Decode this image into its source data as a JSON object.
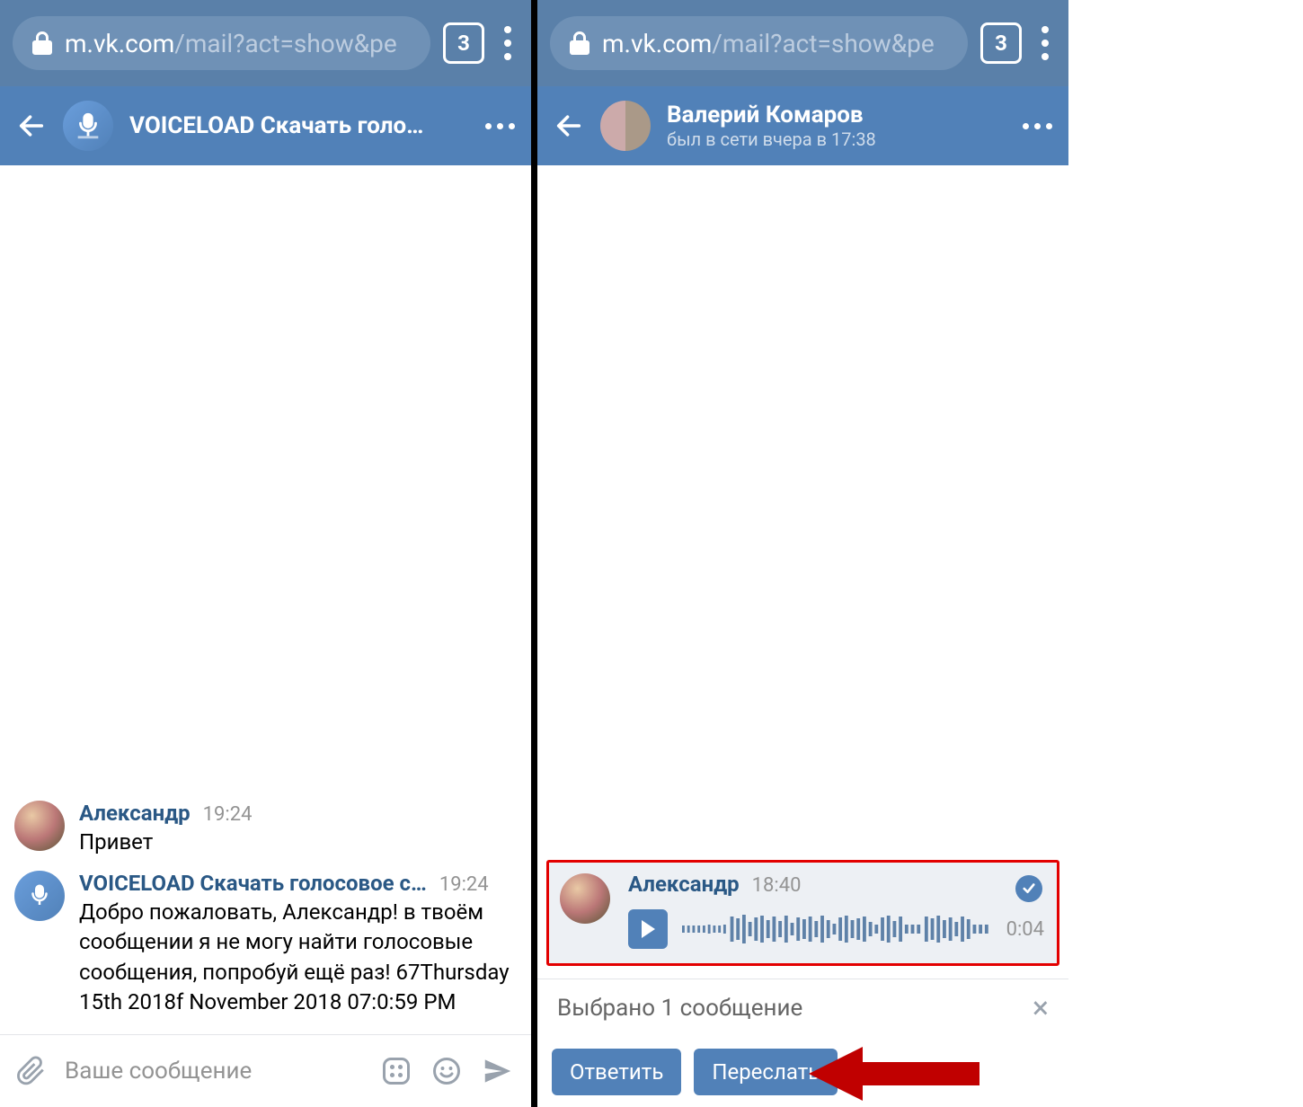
{
  "browser": {
    "url_host": "m.vk.com",
    "url_path": "/mail?act=show&pe",
    "tab_count": "3"
  },
  "left": {
    "header": {
      "title": "VOICELOAD Скачать голо…"
    },
    "messages": [
      {
        "sender": "Александр",
        "time": "19:24",
        "text": "Привет"
      },
      {
        "sender": "VOICELOAD Скачать голосовое с…",
        "time": "19:24",
        "text": "Добро пожаловать, Александр! в твоём сообщении я не могу найти голосовые сообщения, попробуй ещё раз! 67Thursday 15th 2018f November 2018 07:0:59 PM"
      }
    ],
    "composer_placeholder": "Ваше сообщение"
  },
  "right": {
    "header": {
      "title": "Валерий Комаров",
      "subtitle": "был в сети вчера в 17:38"
    },
    "voice": {
      "sender": "Александр",
      "time": "18:40",
      "duration": "0:04"
    },
    "selection": {
      "status": "Выбрано 1 сообщение",
      "reply": "Ответить",
      "forward": "Переслать"
    }
  }
}
